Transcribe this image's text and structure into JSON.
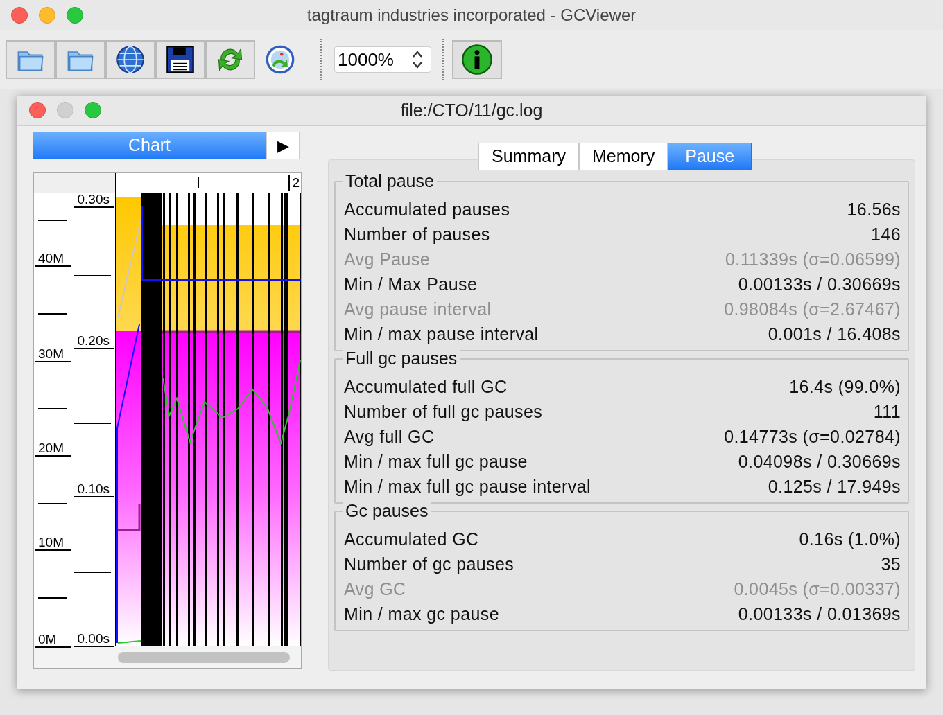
{
  "window": {
    "title": "tagtraum industries incorporated - GCViewer"
  },
  "toolbar": {
    "zoom": {
      "value": "1000%"
    }
  },
  "document": {
    "title": "file:/CTO/11/gc.log",
    "chart_panel": {
      "button": "Chart",
      "arrow": "▶",
      "top_labels": [
        "2"
      ],
      "memory_ticks": [
        "40M",
        "30M",
        "20M",
        "10M",
        "0M"
      ],
      "pause_ticks": [
        "0.30s",
        "0.20s",
        "0.10s",
        "0.00s"
      ]
    },
    "tabs": [
      {
        "label": "Summary",
        "selected": false
      },
      {
        "label": "Memory",
        "selected": false
      },
      {
        "label": "Pause",
        "selected": true
      }
    ],
    "groups": [
      {
        "title": "Total pause",
        "rows": [
          {
            "label": "Accumulated pauses",
            "value": "16.56s",
            "muted": false
          },
          {
            "label": "Number of pauses",
            "value": "146",
            "muted": false
          },
          {
            "label": "Avg Pause",
            "value": "0.11339s (σ=0.06599)",
            "muted": true
          },
          {
            "label": "Min / Max Pause",
            "value": "0.00133s / 0.30669s",
            "muted": false
          },
          {
            "label": "Avg pause interval",
            "value": "0.98084s (σ=2.67467)",
            "muted": true
          },
          {
            "label": "Min / max pause interval",
            "value": "0.001s / 16.408s",
            "muted": false
          }
        ]
      },
      {
        "title": "Full gc pauses",
        "rows": [
          {
            "label": "Accumulated full GC",
            "value": "16.4s (99.0%)",
            "muted": false
          },
          {
            "label": "Number of full gc pauses",
            "value": "111",
            "muted": false
          },
          {
            "label": "Avg full GC",
            "value": "0.14773s (σ=0.02784)",
            "muted": false
          },
          {
            "label": "Min / max full gc pause",
            "value": "0.04098s / 0.30669s",
            "muted": false
          },
          {
            "label": "Min / max full gc pause interval",
            "value": "0.125s / 17.949s",
            "muted": false
          }
        ]
      },
      {
        "title": "Gc pauses",
        "rows": [
          {
            "label": "Accumulated GC",
            "value": "0.16s (1.0%)",
            "muted": false
          },
          {
            "label": "Number of gc pauses",
            "value": "35",
            "muted": false
          },
          {
            "label": "Avg GC",
            "value": "0.0045s (σ=0.00337)",
            "muted": true
          },
          {
            "label": "Min / max gc pause",
            "value": "0.00133s / 0.01369s",
            "muted": false
          }
        ]
      }
    ]
  }
}
